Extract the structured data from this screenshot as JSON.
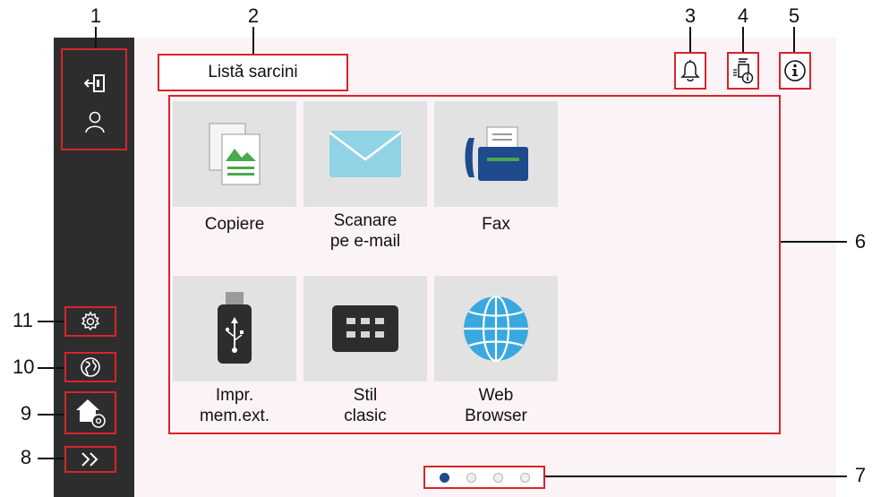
{
  "callouts": [
    "1",
    "2",
    "3",
    "4",
    "5",
    "6",
    "7",
    "8",
    "9",
    "10",
    "11"
  ],
  "header": {
    "task_list_label": "Listă sarcini"
  },
  "tiles": [
    {
      "label": "Copiere",
      "icon": "copy-icon"
    },
    {
      "label": "Scanare\npe e-mail",
      "icon": "envelope-icon"
    },
    {
      "label": "Fax",
      "icon": "fax-icon"
    },
    {
      "label": "Impr.\nmem.ext.",
      "icon": "usb-drive-icon"
    },
    {
      "label": "Stil\nclasic",
      "icon": "classic-style-icon"
    },
    {
      "label": "Web\nBrowser",
      "icon": "globe-icon"
    }
  ],
  "sidebar_icons": [
    "logout-icon",
    "user-icon",
    "gear-icon",
    "language-globe-icon",
    "home-settings-icon",
    "chevrons-right-icon"
  ],
  "top_icons": [
    "bell-icon",
    "device-info-icon",
    "info-icon"
  ],
  "pager": {
    "pages": 4,
    "current": 1
  },
  "colors": {
    "accent": "#d9242b",
    "sidebar": "#2d2d2d",
    "active_dot": "#1f4a8e",
    "tile_bg": "#e2e2e2"
  }
}
